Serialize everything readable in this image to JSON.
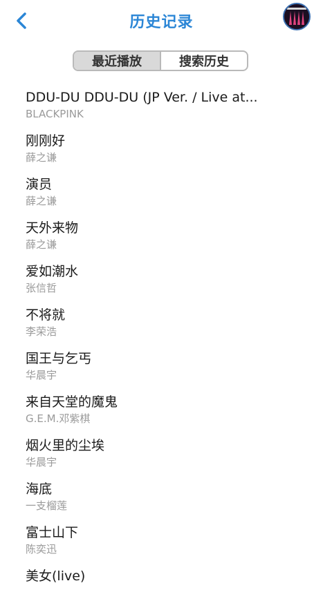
{
  "header": {
    "title": "历史记录",
    "back_icon": "chevron-left-icon",
    "accent_color": "#2b86d6",
    "avatar_icon": "album-avatar"
  },
  "tabs": [
    {
      "label": "最近播放",
      "active": true
    },
    {
      "label": "搜索历史",
      "active": false
    }
  ],
  "history": [
    {
      "song": "DDU-DU DDU-DU (JP Ver. / Live at...",
      "artist": "BLACKPINK"
    },
    {
      "song": "刚刚好",
      "artist": "薛之谦"
    },
    {
      "song": "演员",
      "artist": "薛之谦"
    },
    {
      "song": "天外来物",
      "artist": "薛之谦"
    },
    {
      "song": "爱如潮水",
      "artist": "张信哲"
    },
    {
      "song": "不将就",
      "artist": "李荣浩"
    },
    {
      "song": "国王与乞丐",
      "artist": "华晨宇"
    },
    {
      "song": "来自天堂的魔鬼",
      "artist": "G.E.M.邓紫棋"
    },
    {
      "song": "烟火里的尘埃",
      "artist": "华晨宇"
    },
    {
      "song": "海底",
      "artist": "一支榴莲"
    },
    {
      "song": "富士山下",
      "artist": "陈奕迅"
    },
    {
      "song": "美女(live)",
      "artist": ""
    }
  ]
}
